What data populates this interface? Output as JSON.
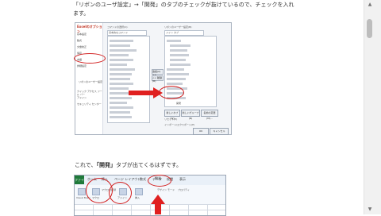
{
  "article": {
    "para1_line1": "「リボンのユーザ設定」→「開発」のタブのチェックが抜けているので、チェックを入れ",
    "para1_line2": "ます。",
    "para2_prefix": "これで、",
    "para2_highlight": "「開発」",
    "para2_suffix": "タブが出てくるはずです。"
  },
  "dialog": {
    "sidebar_title": "Excelのオプション",
    "sidebar_items": [
      "基本設定",
      "数式",
      "文章校正",
      "保存",
      "言語",
      "詳細設定",
      "リボンのユーザー設定",
      "クイック アクセス ツール バー",
      "アドイン",
      "セキュリティ センター"
    ],
    "selected_item": "リボンのユーザー設定",
    "left_header": "コマンドの選択(C):",
    "left_combo": "基本的なコマンド",
    "right_header": "リボンのユーザー設定(B):",
    "right_combo": "メイン タブ",
    "add_button": "追加(A) >>",
    "remove_button": "<< 削除(R)",
    "checked_tab_label": "開発",
    "new_tab_button": "新しいタブ(W)",
    "new_group_button": "新しいグループ(N)",
    "rename_button": "名前の変更(M)...",
    "reset_label": "リセット(E)",
    "import_export_label": "インポート/エクスポート(P)",
    "ok_button": "OK",
    "cancel_button": "キャンセル"
  },
  "excel": {
    "file_tab": "ファイル",
    "tabs": [
      "ホーム",
      "挿入",
      "ページ レイアウト",
      "数式",
      "データ",
      "校閲",
      "表示",
      "開発"
    ],
    "highlighted_tab": "開発",
    "ribbon_labels": [
      "Visual Basic",
      "マクロ",
      "マクロの記録",
      "アドイン",
      "挿入",
      "デザイン モード",
      "プロパティ"
    ]
  },
  "colors": {
    "annotation": "#e02020",
    "excel_green": "#1f7a3a"
  },
  "icons": [
    "scroll-up-arrow-icon",
    "scroll-down-arrow-icon",
    "right-arrow-icon",
    "up-arrow-icon"
  ]
}
